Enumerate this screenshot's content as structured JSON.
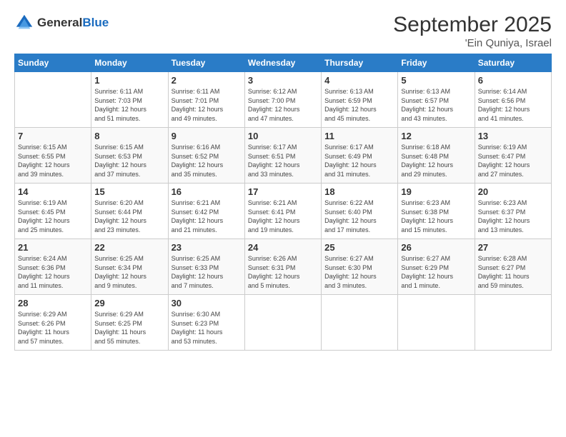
{
  "logo": {
    "general": "General",
    "blue": "Blue"
  },
  "title": "September 2025",
  "location": "'Ein Quniya, Israel",
  "weekdays": [
    "Sunday",
    "Monday",
    "Tuesday",
    "Wednesday",
    "Thursday",
    "Friday",
    "Saturday"
  ],
  "weeks": [
    [
      {
        "day": "",
        "info": ""
      },
      {
        "day": "1",
        "info": "Sunrise: 6:11 AM\nSunset: 7:03 PM\nDaylight: 12 hours\nand 51 minutes."
      },
      {
        "day": "2",
        "info": "Sunrise: 6:11 AM\nSunset: 7:01 PM\nDaylight: 12 hours\nand 49 minutes."
      },
      {
        "day": "3",
        "info": "Sunrise: 6:12 AM\nSunset: 7:00 PM\nDaylight: 12 hours\nand 47 minutes."
      },
      {
        "day": "4",
        "info": "Sunrise: 6:13 AM\nSunset: 6:59 PM\nDaylight: 12 hours\nand 45 minutes."
      },
      {
        "day": "5",
        "info": "Sunrise: 6:13 AM\nSunset: 6:57 PM\nDaylight: 12 hours\nand 43 minutes."
      },
      {
        "day": "6",
        "info": "Sunrise: 6:14 AM\nSunset: 6:56 PM\nDaylight: 12 hours\nand 41 minutes."
      }
    ],
    [
      {
        "day": "7",
        "info": "Sunrise: 6:15 AM\nSunset: 6:55 PM\nDaylight: 12 hours\nand 39 minutes."
      },
      {
        "day": "8",
        "info": "Sunrise: 6:15 AM\nSunset: 6:53 PM\nDaylight: 12 hours\nand 37 minutes."
      },
      {
        "day": "9",
        "info": "Sunrise: 6:16 AM\nSunset: 6:52 PM\nDaylight: 12 hours\nand 35 minutes."
      },
      {
        "day": "10",
        "info": "Sunrise: 6:17 AM\nSunset: 6:51 PM\nDaylight: 12 hours\nand 33 minutes."
      },
      {
        "day": "11",
        "info": "Sunrise: 6:17 AM\nSunset: 6:49 PM\nDaylight: 12 hours\nand 31 minutes."
      },
      {
        "day": "12",
        "info": "Sunrise: 6:18 AM\nSunset: 6:48 PM\nDaylight: 12 hours\nand 29 minutes."
      },
      {
        "day": "13",
        "info": "Sunrise: 6:19 AM\nSunset: 6:47 PM\nDaylight: 12 hours\nand 27 minutes."
      }
    ],
    [
      {
        "day": "14",
        "info": "Sunrise: 6:19 AM\nSunset: 6:45 PM\nDaylight: 12 hours\nand 25 minutes."
      },
      {
        "day": "15",
        "info": "Sunrise: 6:20 AM\nSunset: 6:44 PM\nDaylight: 12 hours\nand 23 minutes."
      },
      {
        "day": "16",
        "info": "Sunrise: 6:21 AM\nSunset: 6:42 PM\nDaylight: 12 hours\nand 21 minutes."
      },
      {
        "day": "17",
        "info": "Sunrise: 6:21 AM\nSunset: 6:41 PM\nDaylight: 12 hours\nand 19 minutes."
      },
      {
        "day": "18",
        "info": "Sunrise: 6:22 AM\nSunset: 6:40 PM\nDaylight: 12 hours\nand 17 minutes."
      },
      {
        "day": "19",
        "info": "Sunrise: 6:23 AM\nSunset: 6:38 PM\nDaylight: 12 hours\nand 15 minutes."
      },
      {
        "day": "20",
        "info": "Sunrise: 6:23 AM\nSunset: 6:37 PM\nDaylight: 12 hours\nand 13 minutes."
      }
    ],
    [
      {
        "day": "21",
        "info": "Sunrise: 6:24 AM\nSunset: 6:36 PM\nDaylight: 12 hours\nand 11 minutes."
      },
      {
        "day": "22",
        "info": "Sunrise: 6:25 AM\nSunset: 6:34 PM\nDaylight: 12 hours\nand 9 minutes."
      },
      {
        "day": "23",
        "info": "Sunrise: 6:25 AM\nSunset: 6:33 PM\nDaylight: 12 hours\nand 7 minutes."
      },
      {
        "day": "24",
        "info": "Sunrise: 6:26 AM\nSunset: 6:31 PM\nDaylight: 12 hours\nand 5 minutes."
      },
      {
        "day": "25",
        "info": "Sunrise: 6:27 AM\nSunset: 6:30 PM\nDaylight: 12 hours\nand 3 minutes."
      },
      {
        "day": "26",
        "info": "Sunrise: 6:27 AM\nSunset: 6:29 PM\nDaylight: 12 hours\nand 1 minute."
      },
      {
        "day": "27",
        "info": "Sunrise: 6:28 AM\nSunset: 6:27 PM\nDaylight: 11 hours\nand 59 minutes."
      }
    ],
    [
      {
        "day": "28",
        "info": "Sunrise: 6:29 AM\nSunset: 6:26 PM\nDaylight: 11 hours\nand 57 minutes."
      },
      {
        "day": "29",
        "info": "Sunrise: 6:29 AM\nSunset: 6:25 PM\nDaylight: 11 hours\nand 55 minutes."
      },
      {
        "day": "30",
        "info": "Sunrise: 6:30 AM\nSunset: 6:23 PM\nDaylight: 11 hours\nand 53 minutes."
      },
      {
        "day": "",
        "info": ""
      },
      {
        "day": "",
        "info": ""
      },
      {
        "day": "",
        "info": ""
      },
      {
        "day": "",
        "info": ""
      }
    ]
  ]
}
